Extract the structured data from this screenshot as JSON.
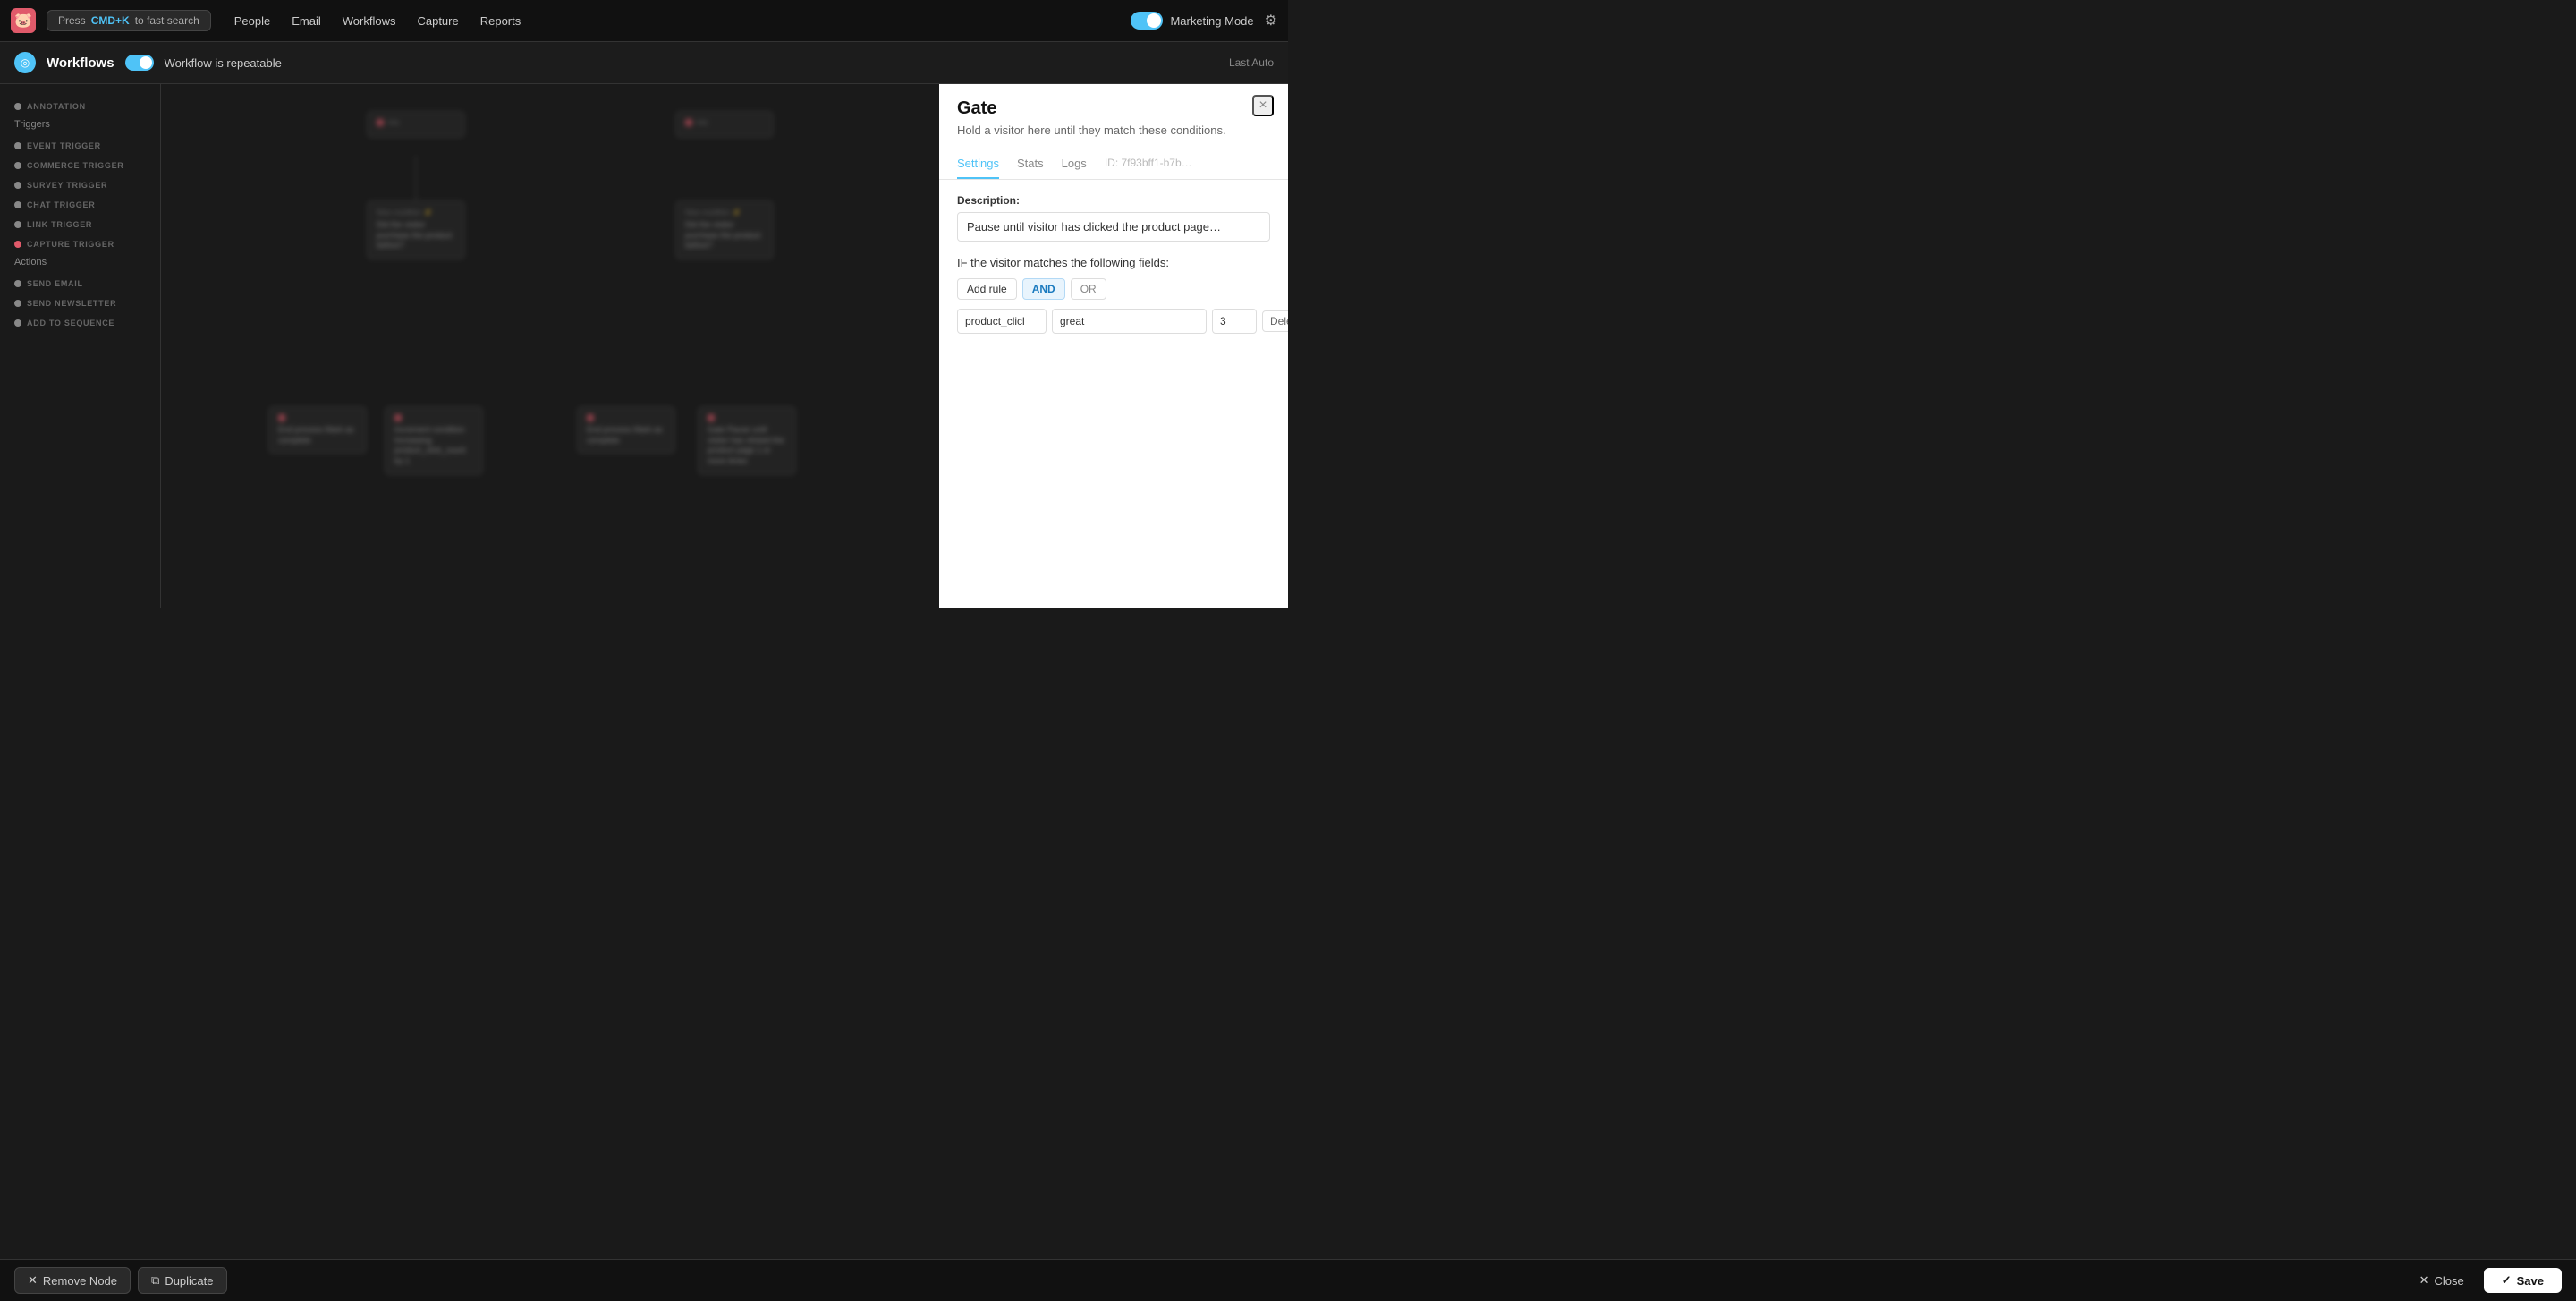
{
  "topNav": {
    "logo": "🐷",
    "searchPlaceholder": "Press CMD+K to fast search",
    "searchCmdKey": "CMD+K",
    "links": [
      "People",
      "Email",
      "Workflows",
      "Capture",
      "Reports"
    ],
    "marketingMode": "Marketing Mode",
    "gearIcon": "⚙"
  },
  "subNav": {
    "workflowIcon": "◎",
    "title": "Workflows",
    "repeatableLabel": "Workflow is repeatable",
    "lastAuto": "Last Auto"
  },
  "sidebar": {
    "sections": [
      {
        "title": "ANNOTATION",
        "dotColor": "#888",
        "items": [
          "Triggers"
        ]
      },
      {
        "title": "EVENT TRIGGER",
        "dotColor": "#888",
        "items": []
      },
      {
        "title": "COMMERCE TRIGGER",
        "dotColor": "#888",
        "items": []
      },
      {
        "title": "SURVEY TRIGGER",
        "dotColor": "#888",
        "items": []
      },
      {
        "title": "CHAT TRIGGER",
        "dotColor": "#888",
        "items": []
      },
      {
        "title": "LINK TRIGGER",
        "dotColor": "#888",
        "items": []
      },
      {
        "title": "CAPTURE TRIGGER",
        "dotColor": "#e05a6a",
        "items": [
          "Actions"
        ]
      },
      {
        "title": "SEND EMAIL",
        "dotColor": "#888",
        "items": []
      },
      {
        "title": "SEND NEWSLETTER",
        "dotColor": "#888",
        "items": []
      },
      {
        "title": "ADD TO SEQUENCE",
        "dotColor": "#888",
        "items": []
      }
    ]
  },
  "panel": {
    "title": "Gate",
    "subtitle": "Hold a visitor here until they match these conditions.",
    "closeIcon": "×",
    "tabs": [
      {
        "label": "Settings",
        "active": true
      },
      {
        "label": "Stats",
        "active": false
      },
      {
        "label": "Logs",
        "active": false
      },
      {
        "label": "ID: 7f93bff1-b7b…",
        "active": false,
        "isId": true
      }
    ],
    "description": {
      "label": "Description:",
      "value": "Pause until visitor has clicked the product page…"
    },
    "ifLabel": "IF the visitor matches the following fields:",
    "addRuleBtn": "Add rule",
    "andBtn": "AND",
    "orBtn": "OR",
    "rule": {
      "field": "product_clicl",
      "operator": "great",
      "value": "3",
      "deleteBtn": "Delete"
    }
  },
  "bottomBar": {
    "removeNodeIcon": "✕",
    "removeNodeLabel": "Remove Node",
    "duplicateIcon": "⧉",
    "duplicateLabel": "Duplicate",
    "closeIcon": "✕",
    "closeLabel": "Close",
    "saveIcon": "✓",
    "saveLabel": "Save"
  }
}
